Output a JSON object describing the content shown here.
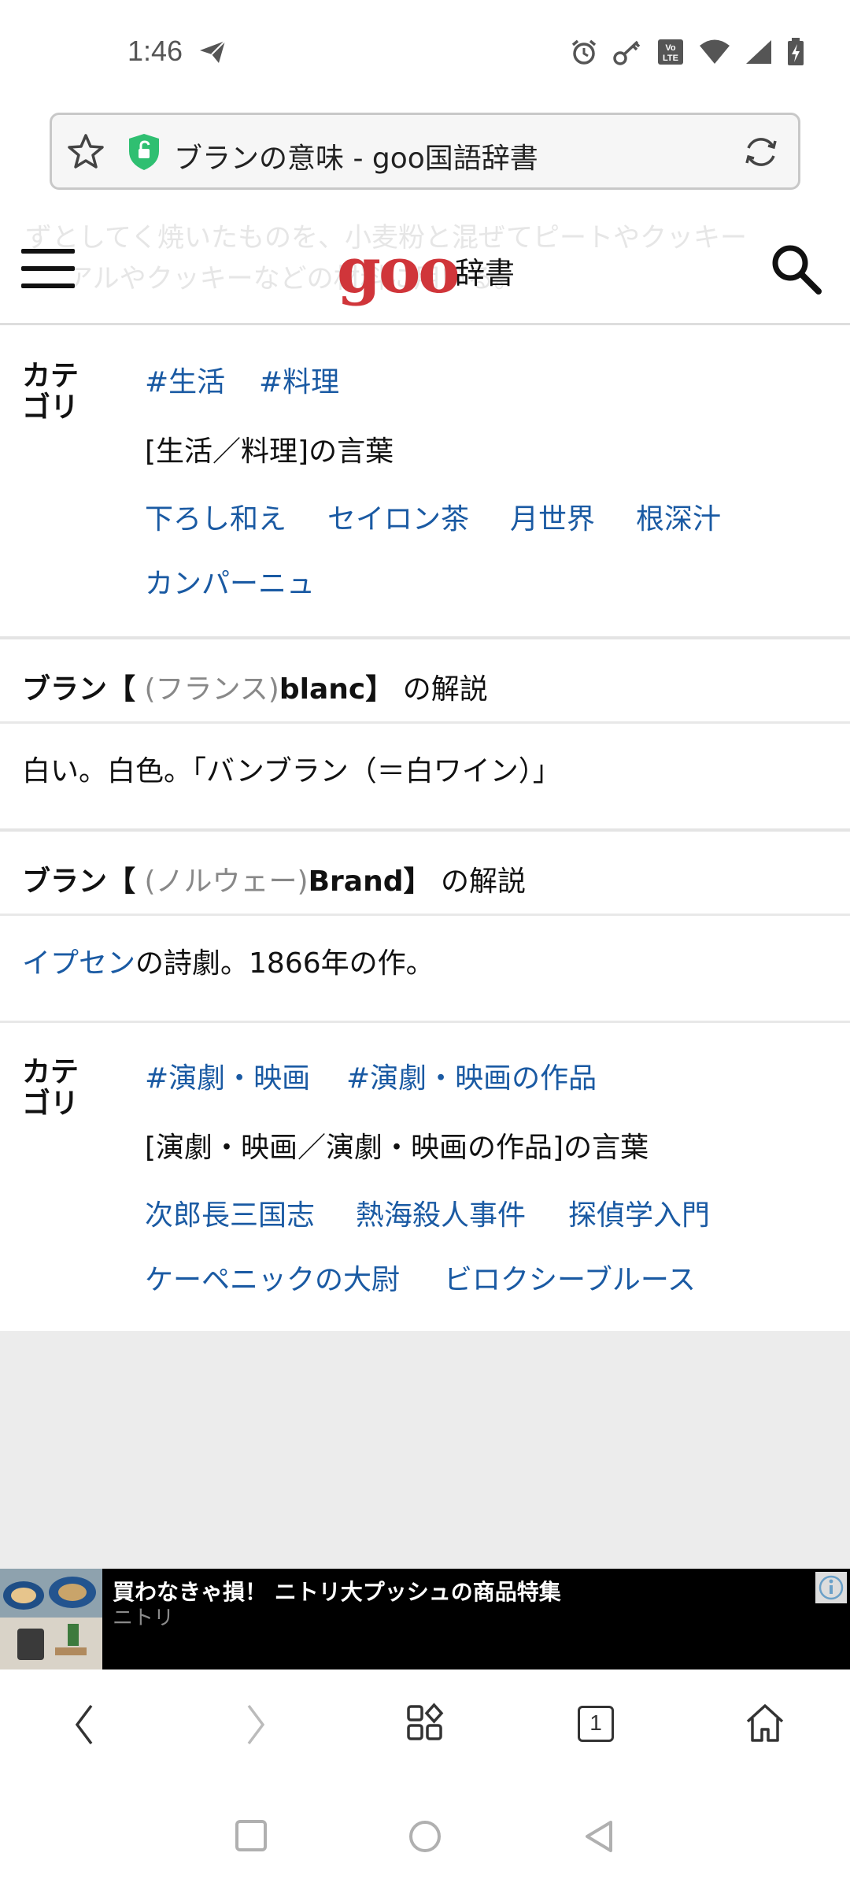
{
  "status_bar": {
    "time": "1:46",
    "icons": [
      "send-icon",
      "alarm-icon",
      "key-icon",
      "volte-icon",
      "wifi-icon",
      "signal-icon",
      "battery-charging-icon"
    ],
    "volte_text": "Vo LTE"
  },
  "url_bar": {
    "title": "ブランの意味 - goo国語辞書",
    "shield_color": "#2fbf71"
  },
  "header": {
    "faded_line1": "ずとしてく焼いたものを、小麦粉と混ぜてピートやクッキー",
    "faded_line2": "アルやクッキーなどの材料に用いる。",
    "logo": "goo",
    "logo_sub": "辞書",
    "logo_color": "#d0353a"
  },
  "category1": {
    "label": "カテゴリ",
    "tags": [
      "#生活",
      "#料理"
    ],
    "words_heading": "[生活／料理]の言葉",
    "words": [
      "下ろし和え",
      "セイロン茶",
      "月世界",
      "根深汁",
      "カンパーニュ"
    ]
  },
  "entry_blanc": {
    "word": "ブラン",
    "bracket_open": "【",
    "lang": "(フランス)",
    "origin": "blanc",
    "bracket_close": "】",
    "suffix": "の解説",
    "definition": "白い。白色。「バンブラン（＝白ワイン）」"
  },
  "entry_brand": {
    "word": "ブラン",
    "bracket_open": "【",
    "lang": "(ノルウェー)",
    "origin": "Brand",
    "bracket_close": "】",
    "suffix": "の解説",
    "definition_link": "イプセン",
    "definition_rest": "の詩劇。1866年の作。"
  },
  "category2": {
    "label": "カテゴリ",
    "tags": [
      "#演劇・映画",
      "#演劇・映画の作品"
    ],
    "words_heading": "[演劇・映画／演劇・映画の作品]の言葉",
    "words": [
      "次郎長三国志",
      "熱海殺人事件",
      "探偵学入門",
      "ケーペニックの大尉",
      "ビロクシーブルース"
    ]
  },
  "ad": {
    "title": "買わなきゃ損！ ニトリ大プッシュの商品特集",
    "advertiser": "ニトリ"
  },
  "browser_nav": {
    "tab_count": "1"
  },
  "colors": {
    "link": "#1a5aa3",
    "divider": "#e4e4e4"
  }
}
